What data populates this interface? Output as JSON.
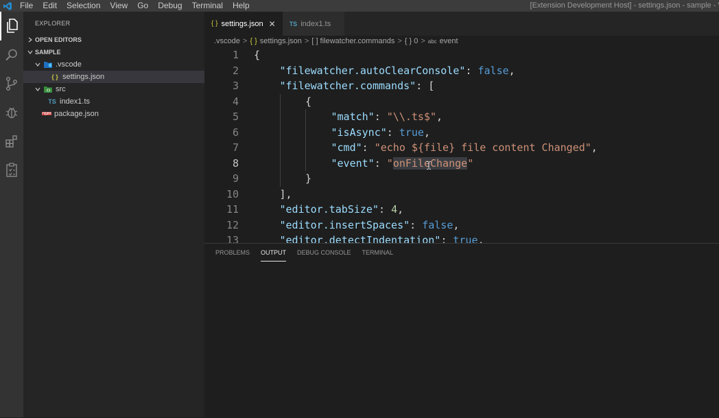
{
  "menu": [
    "File",
    "Edit",
    "Selection",
    "View",
    "Go",
    "Debug",
    "Terminal",
    "Help"
  ],
  "window_title": "[Extension Development Host] - settings.json - sample - Vi",
  "activity_icons": [
    "files-icon",
    "search-icon",
    "source-control-icon",
    "debug-icon",
    "extensions-icon",
    "tasks-icon"
  ],
  "sidebar": {
    "title": "EXPLORER",
    "open_editors": "OPEN EDITORS",
    "workspace": "SAMPLE",
    "tree": {
      "vscode_folder": ".vscode",
      "settings_file": "settings.json",
      "settings_icon": "{ }",
      "src_folder": "src",
      "index_file": "index1.ts",
      "ts_icon": "TS",
      "package_file": "package.json"
    }
  },
  "tabs": [
    {
      "label": "settings.json",
      "icon": "{ }",
      "active": true,
      "close": "✕"
    },
    {
      "label": "index1.ts",
      "icon": "TS",
      "active": false
    }
  ],
  "breadcrumb": {
    "folder": ".vscode",
    "file_icon": "{ }",
    "file": "settings.json",
    "array_icon": "[ ]",
    "key": "filewatcher.commands",
    "obj_icon": "{ }",
    "index": "0",
    "str_icon": "abc",
    "prop": "event",
    "sep": ">"
  },
  "code_lines": [
    {
      "n": "1",
      "indent": 0,
      "parts": [
        [
          "p",
          "{"
        ]
      ]
    },
    {
      "n": "2",
      "indent": 1,
      "parts": [
        [
          "k",
          "\"filewatcher.autoClearConsole\""
        ],
        [
          "p",
          ": "
        ],
        [
          "b",
          "false"
        ],
        [
          "p",
          ","
        ]
      ]
    },
    {
      "n": "3",
      "indent": 1,
      "parts": [
        [
          "k",
          "\"filewatcher.commands\""
        ],
        [
          "p",
          ": ["
        ]
      ]
    },
    {
      "n": "4",
      "indent": 2,
      "parts": [
        [
          "p",
          "{"
        ]
      ]
    },
    {
      "n": "5",
      "indent": 3,
      "parts": [
        [
          "k",
          "\"match\""
        ],
        [
          "p",
          ": "
        ],
        [
          "s",
          "\"\\\\.ts$\""
        ],
        [
          "p",
          ","
        ]
      ]
    },
    {
      "n": "6",
      "indent": 3,
      "parts": [
        [
          "k",
          "\"isAsync\""
        ],
        [
          "p",
          ": "
        ],
        [
          "b",
          "true"
        ],
        [
          "p",
          ","
        ]
      ]
    },
    {
      "n": "7",
      "indent": 3,
      "parts": [
        [
          "k",
          "\"cmd\""
        ],
        [
          "p",
          ": "
        ],
        [
          "s",
          "\"echo ${file} file content Changed\""
        ],
        [
          "p",
          ","
        ]
      ]
    },
    {
      "n": "8",
      "indent": 3,
      "current": true,
      "parts": [
        [
          "k",
          "\"event\""
        ],
        [
          "p",
          ": "
        ],
        [
          "s",
          "\""
        ],
        [
          "s hl",
          "onFileChange"
        ],
        [
          "s",
          "\""
        ]
      ]
    },
    {
      "n": "9",
      "indent": 2,
      "parts": [
        [
          "p",
          "}"
        ]
      ]
    },
    {
      "n": "10",
      "indent": 1,
      "parts": [
        [
          "p",
          "],"
        ]
      ]
    },
    {
      "n": "11",
      "indent": 1,
      "parts": [
        [
          "k",
          "\"editor.tabSize\""
        ],
        [
          "p",
          ": "
        ],
        [
          "n",
          "4"
        ],
        [
          "p",
          ","
        ]
      ]
    },
    {
      "n": "12",
      "indent": 1,
      "parts": [
        [
          "k",
          "\"editor.insertSpaces\""
        ],
        [
          "p",
          ": "
        ],
        [
          "b",
          "false"
        ],
        [
          "p",
          ","
        ]
      ]
    },
    {
      "n": "13",
      "indent": 1,
      "parts": [
        [
          "k",
          "\"editor.detectIndentation\""
        ],
        [
          "p",
          ": "
        ],
        [
          "b",
          "true"
        ],
        [
          "p",
          ","
        ]
      ]
    }
  ],
  "panel": {
    "tabs": [
      "PROBLEMS",
      "OUTPUT",
      "DEBUG CONSOLE",
      "TERMINAL"
    ],
    "active_tab": "OUTPUT"
  },
  "colors": {
    "accent_blue": "#007acc",
    "json_yellow": "#cbcb41",
    "ts_blue": "#519aba",
    "npm_red": "#cb3837",
    "folder_green": "#4caf50"
  }
}
